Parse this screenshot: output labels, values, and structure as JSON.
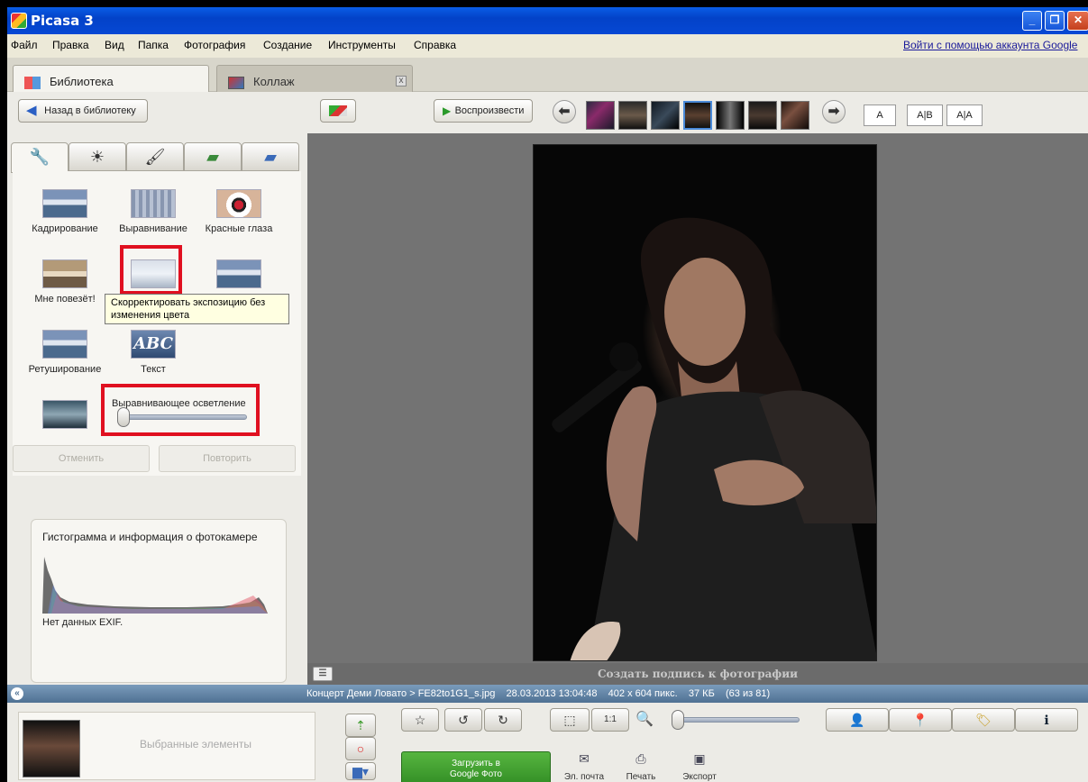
{
  "window": {
    "title": "Picasa 3",
    "min": "_",
    "max": "❐",
    "close": "✕"
  },
  "menu": [
    "Файл",
    "Правка",
    "Вид",
    "Папка",
    "Фотография",
    "Создание",
    "Инструменты",
    "Справка"
  ],
  "login_link": "Войти с помощью аккаунта Google",
  "tabs": {
    "library": "Библиотека",
    "collage": "Коллаж",
    "close": "x"
  },
  "toolbar": {
    "back": "Назад в библиотеку",
    "play": "Воспроизвести",
    "layout_a": "A",
    "layout_ab": "A|B",
    "layout_aa": "A|A"
  },
  "tools": {
    "crop": "Кадрирование",
    "straighten": "Выравнивание",
    "redeye": "Красные глаза",
    "lucky": "Мне повезёт!",
    "retouch": "Ретуширование",
    "text": "Текст",
    "text_icon": "ABC"
  },
  "tooltip": "Скорректировать экспозицию без изменения цвета",
  "fill_light": {
    "label": "Выравнивающее осветление",
    "value": 0
  },
  "undo": "Отменить",
  "redo": "Повторить",
  "histogram": {
    "title": "Гистограмма и информация о фотокамере",
    "exif": "Нет данных EXIF."
  },
  "caption_placeholder": "Создать подпись к фотографии",
  "status": "Концерт Деми Ловато > FE82to1G1_s.jpg    28.03.2013 13:04:48    402 x 604 пикс.    37 КБ    (63 из 81)",
  "tray": {
    "selected": "Выбранные элементы",
    "upload_line1": "Загрузить в",
    "upload_line2": "Google Фото",
    "email": "Эл. почта",
    "print": "Печать",
    "export": "Экспорт",
    "one_to_one": "1:1"
  },
  "colors": {
    "titlebar": "#0648d4",
    "upload_button": "#3a9a2a",
    "highlight": "#e01020"
  }
}
